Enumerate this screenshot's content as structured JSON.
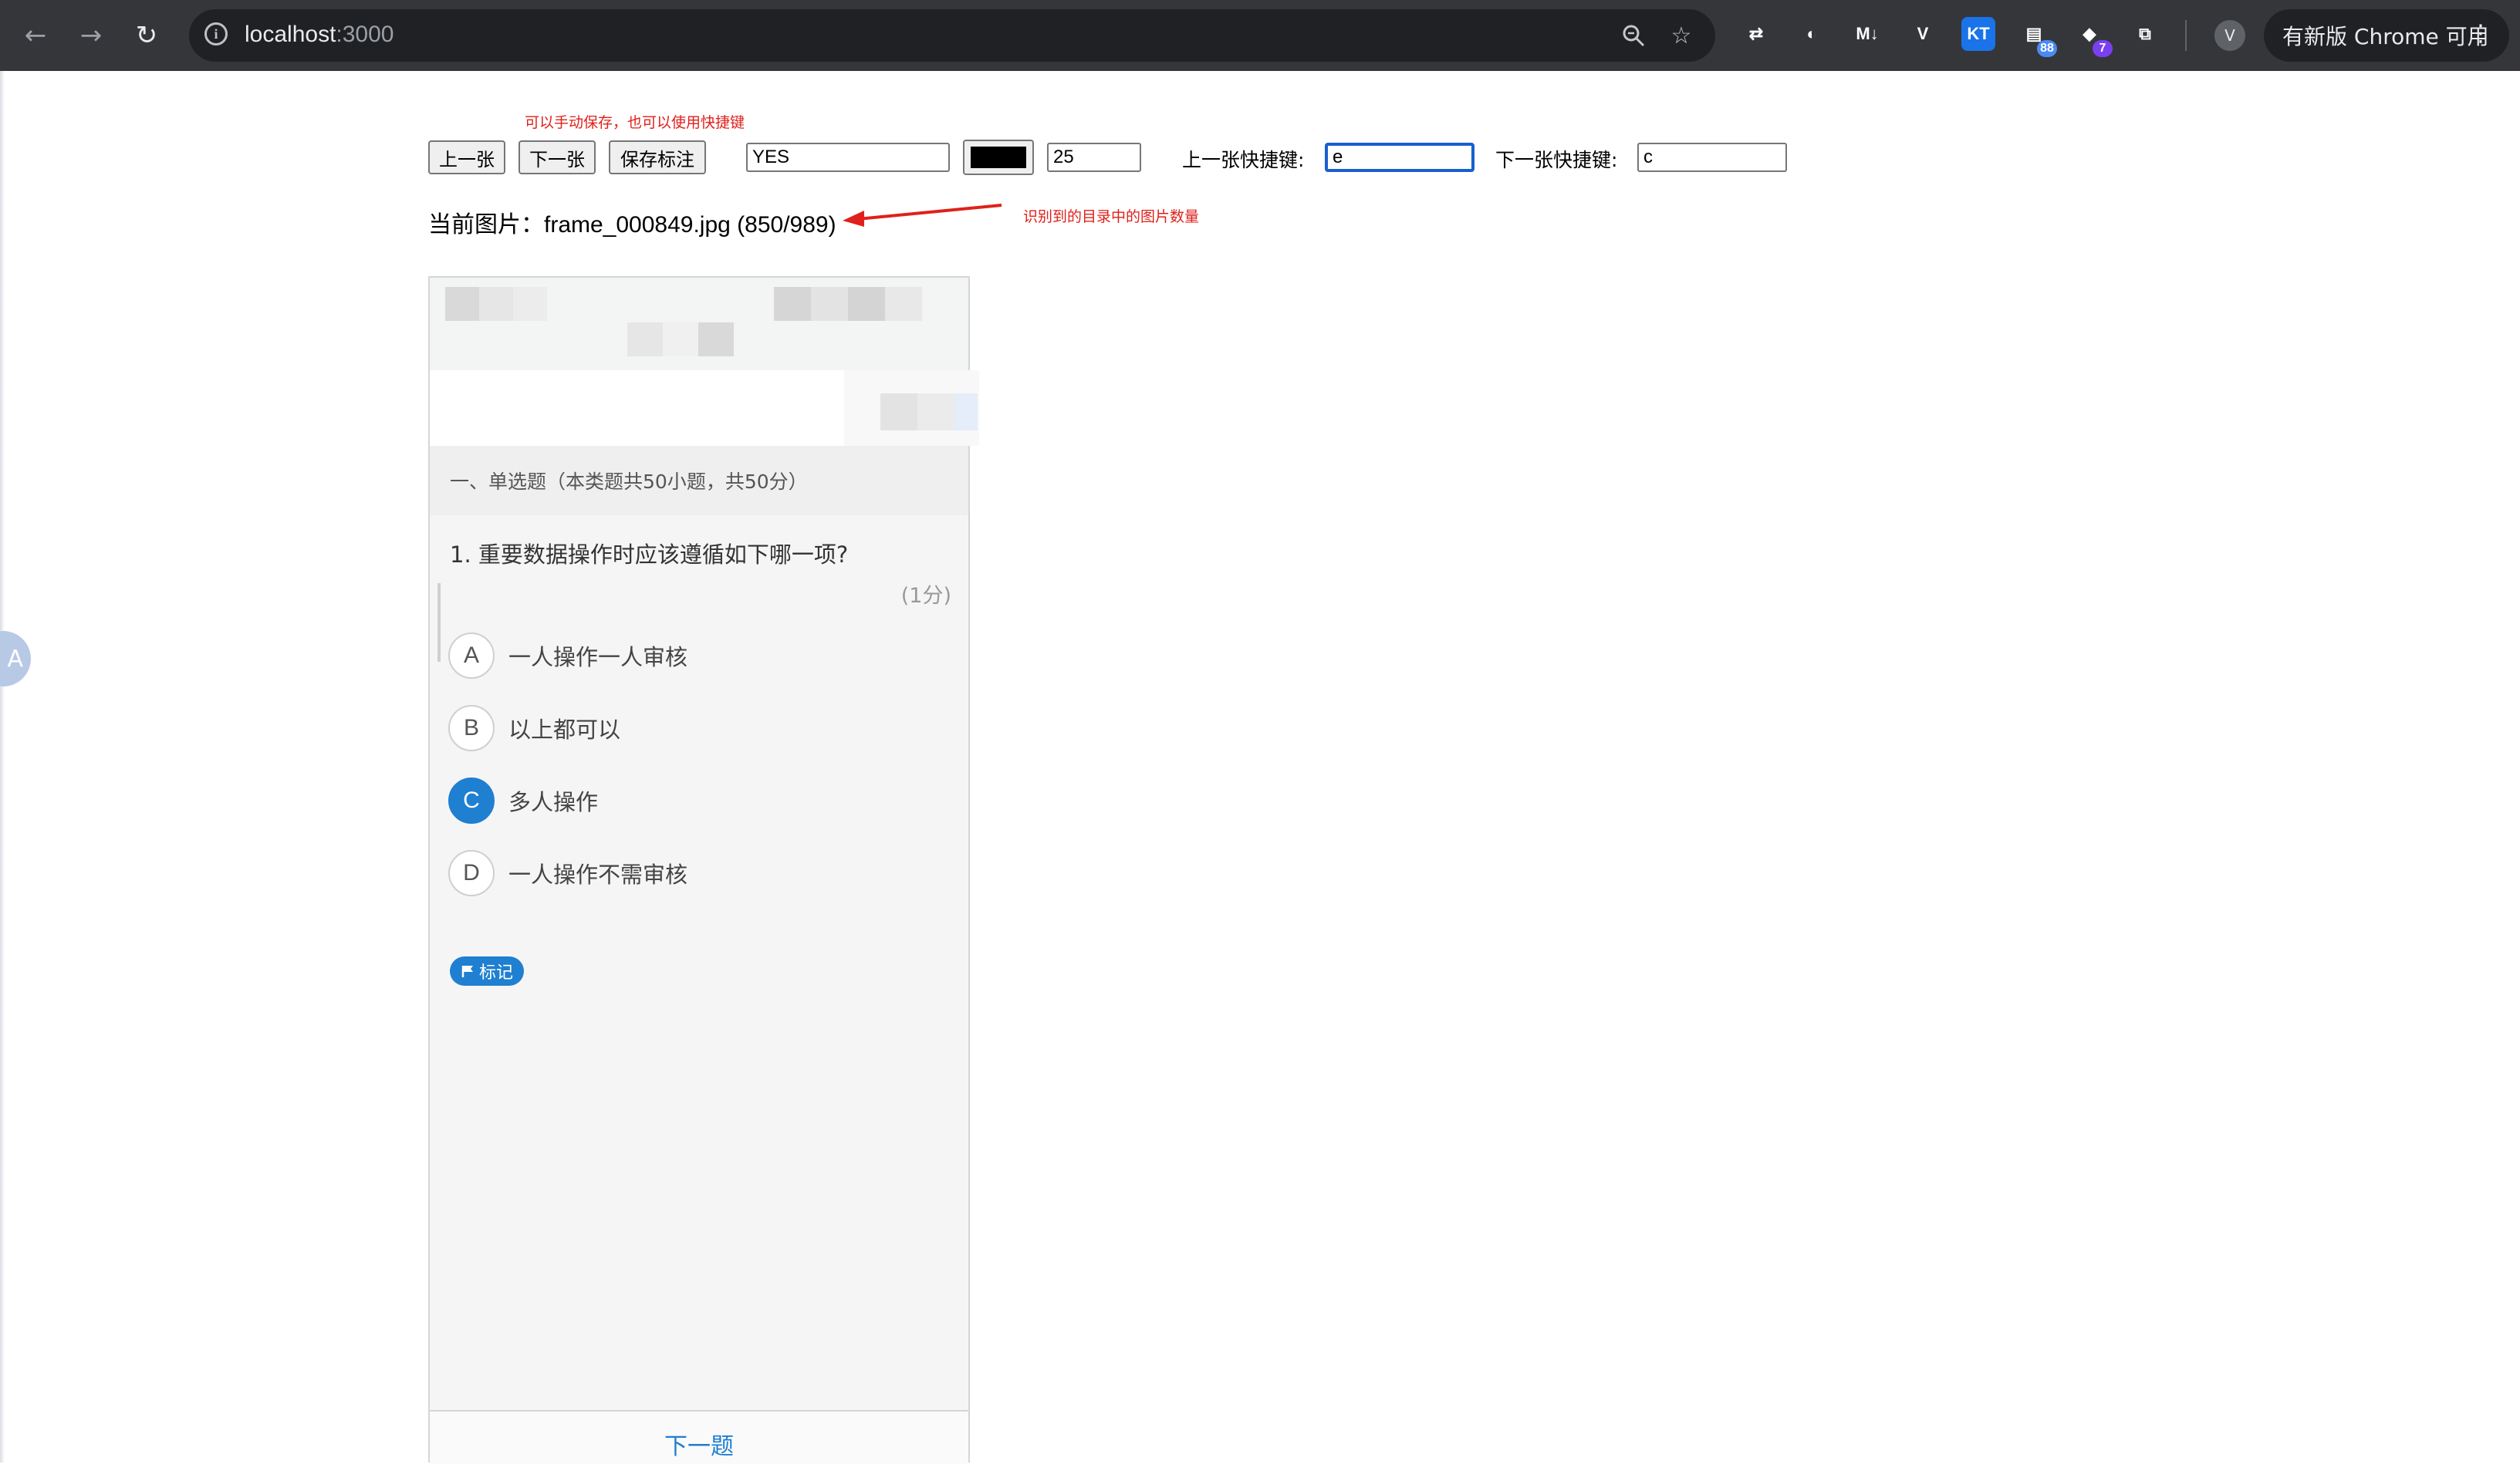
{
  "browser": {
    "url_host": "localhost",
    "url_port": ":3000",
    "update_label": "有新版 Chrome 可用",
    "avatar_letter": "V",
    "extensions": [
      {
        "name": "sync-extension-icon",
        "label": "⇄",
        "color": "#35363a"
      },
      {
        "name": "mask-extension-icon",
        "label": "◐",
        "color": "#35363a"
      },
      {
        "name": "markdown-extension-icon",
        "label": "M↓",
        "color": "#35363a"
      },
      {
        "name": "vue-extension-icon",
        "label": "V",
        "color": "#35363a"
      },
      {
        "name": "kt-extension-icon",
        "label": "KT",
        "color": "#1a73e8"
      },
      {
        "name": "tab-counter-extension-icon",
        "label": "▤",
        "color": "#35363a",
        "badge": "88"
      },
      {
        "name": "gem-extension-icon",
        "label": "◆",
        "color": "#35363a",
        "badge": "7"
      },
      {
        "name": "puzzle-extensions-icon",
        "label": "⧉",
        "color": "#35363a"
      }
    ]
  },
  "toolbar": {
    "hint_save": "可以手动保存，也可以使用快捷键",
    "prev_label": "上一张",
    "next_label": "下一张",
    "save_label": "保存标注",
    "label_value": "YES",
    "color_value": "#000000",
    "size_value": "25",
    "prev_shortcut_label": "上一张快捷键:",
    "prev_shortcut_value": "e",
    "next_shortcut_label": "下一张快捷键:",
    "next_shortcut_value": "c"
  },
  "status": {
    "current_prefix": "当前图片：",
    "current_file": "frame_000849.jpg (850/989)",
    "count_hint": "识别到的目录中的图片数量"
  },
  "preview": {
    "section_title": "一、单选题（本类题共50小题，共50分）",
    "question": "1. 重要数据操作时应该遵循如下哪一项?",
    "score": "(1分)",
    "options": [
      {
        "letter": "A",
        "text": "一人操作一人审核",
        "selected": false
      },
      {
        "letter": "B",
        "text": "以上都可以",
        "selected": false
      },
      {
        "letter": "C",
        "text": "多人操作",
        "selected": true
      },
      {
        "letter": "D",
        "text": "一人操作不需审核",
        "selected": false
      }
    ],
    "mark_label": "标记",
    "next_question_label": "下一题"
  },
  "floating": {
    "label": "A"
  }
}
